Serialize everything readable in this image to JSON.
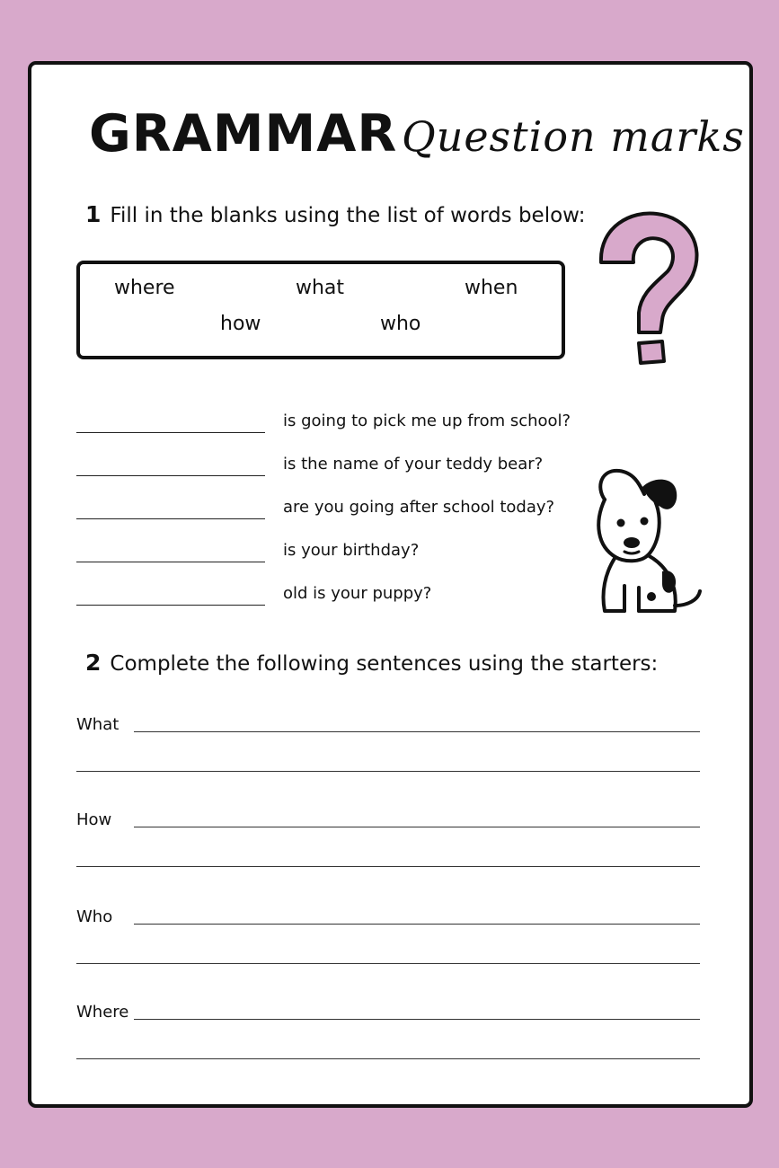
{
  "header": {
    "title": "GRAMMAR",
    "subtitle": "Question marks"
  },
  "section1": {
    "number": "1",
    "instruction": "Fill in the blanks using the list of words below:",
    "word_bank": [
      "where",
      "what",
      "when",
      "how",
      "who"
    ],
    "sentences": [
      "is going to pick me up from school?",
      "is the name of your teddy bear?",
      "are you going after school today?",
      "is your birthday?",
      "old is your puppy?"
    ]
  },
  "section2": {
    "number": "2",
    "instruction": "Complete the following sentences using the starters:",
    "starters": [
      "What",
      "How",
      "Who",
      "Where"
    ]
  },
  "colors": {
    "background": "#d8a9cb",
    "accent": "#d8a9cb",
    "ink": "#111111"
  },
  "icons": [
    "question-mark-icon",
    "puppy-icon"
  ]
}
